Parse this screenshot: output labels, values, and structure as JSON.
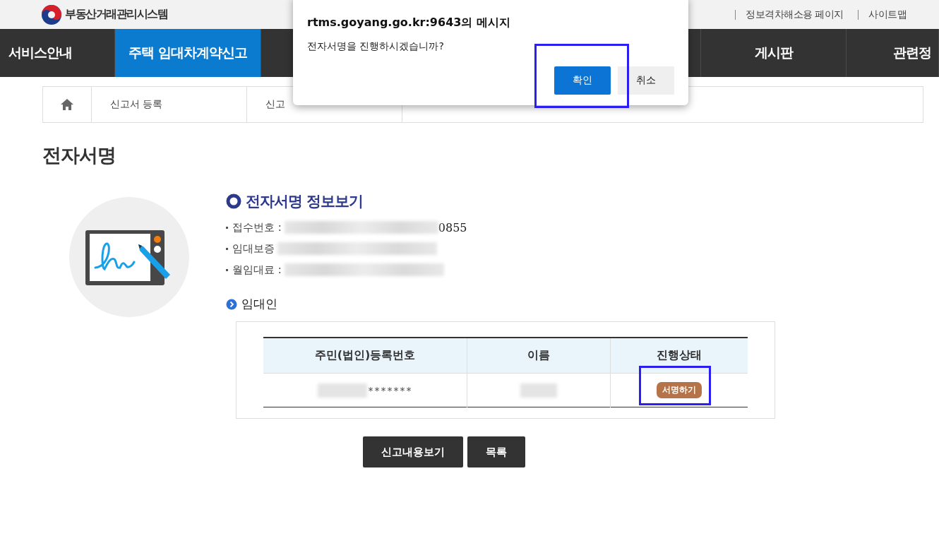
{
  "header": {
    "logo": "부동산거래관리시스템",
    "links": [
      "정보격차해소용 페이지",
      "사이트맵"
    ]
  },
  "nav": {
    "left": [
      {
        "label": "서비스안내",
        "selected": false
      },
      {
        "label": "주택 임대차계약신고",
        "selected": true
      }
    ],
    "right": [
      {
        "label": "게시판",
        "selected": false
      },
      {
        "label": "관련정",
        "selected": false
      }
    ]
  },
  "breadcrumb": [
    "신고서 등록",
    "신고"
  ],
  "page_title": "전자서명",
  "info": {
    "heading": "전자서명 정보보기",
    "lines": [
      {
        "label": "접수번호 :",
        "tail": "0855"
      },
      {
        "label": "임대보증"
      },
      {
        "label": "월임대료 :"
      }
    ]
  },
  "lessor": {
    "heading": "임대인",
    "columns": [
      "주민(법인)등록번호",
      "이름",
      "진행상태"
    ],
    "rows": [
      {
        "id_tail": "*******",
        "status": "서명하기"
      }
    ]
  },
  "buttons": [
    "신고내용보기",
    "목록"
  ],
  "dialog": {
    "title": "rtms.goyang.go.kr:9643의 메시지",
    "message": "전자서명을 진행하시겠습니까?",
    "buttons": [
      {
        "label": "확인",
        "kind": "primary"
      },
      {
        "label": "취소",
        "kind": "secondary"
      }
    ]
  }
}
